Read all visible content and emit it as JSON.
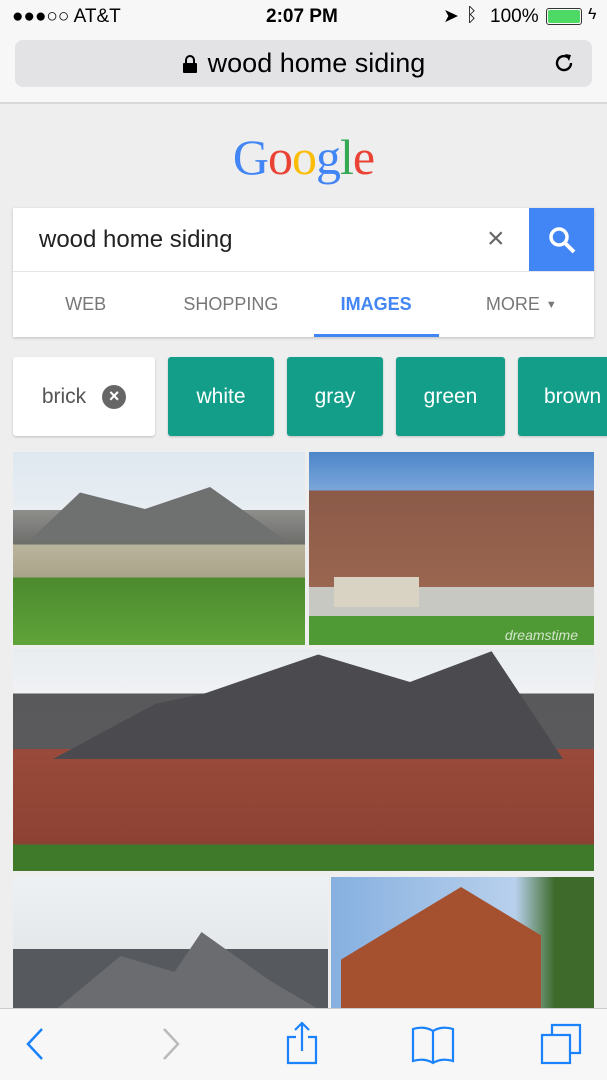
{
  "status_bar": {
    "carrier": "●●●○○ AT&T",
    "time": "2:07 PM",
    "battery": "100%"
  },
  "url_bar": {
    "text": "wood home siding",
    "icons": [
      "lock-icon",
      "reload-icon"
    ]
  },
  "logo": {
    "text": "Google",
    "colors": [
      "#4285f4",
      "#ea4335",
      "#fbbc05",
      "#4285f4",
      "#34a853",
      "#ea4335"
    ]
  },
  "search": {
    "query": "wood home siding",
    "clear_icon": "×",
    "search_color": "#4285f4"
  },
  "tabs": [
    {
      "label": "WEB"
    },
    {
      "label": "SHOPPING"
    },
    {
      "label": "IMAGES",
      "active": true
    },
    {
      "label": "MORE"
    }
  ],
  "chips": [
    {
      "label": "brick",
      "selected": true
    },
    {
      "label": "white"
    },
    {
      "label": "gray"
    },
    {
      "label": "green"
    },
    {
      "label": "brown"
    }
  ],
  "chip_color": "#139e8a",
  "images": [
    {
      "watermark": ""
    },
    {
      "watermark": "dreamstime"
    },
    {
      "watermark": ""
    },
    {
      "watermark": ""
    },
    {
      "watermark": ""
    }
  ],
  "toolbar": {
    "icons": [
      "back-icon",
      "forward-icon",
      "share-icon",
      "bookmarks-icon",
      "tabs-icon"
    ]
  }
}
